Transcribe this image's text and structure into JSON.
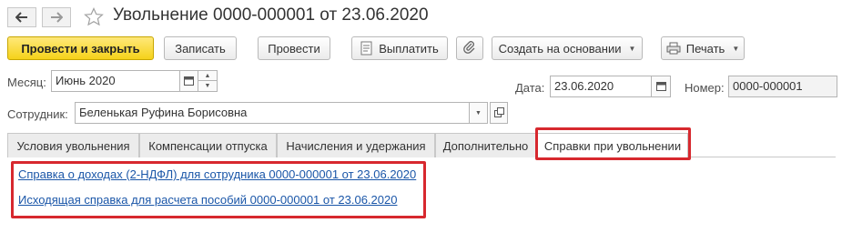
{
  "window": {
    "title": "Увольнение 0000-000001 от 23.06.2020"
  },
  "toolbar": {
    "post_close_label": "Провести и закрыть",
    "save_label": "Записать",
    "post_label": "Провести",
    "pay_label": "Выплатить",
    "create_based_label": "Создать на основании",
    "print_label": "Печать"
  },
  "form": {
    "month_label": "Месяц:",
    "month_value": "Июнь 2020",
    "date_label": "Дата:",
    "date_value": "23.06.2020",
    "number_label": "Номер:",
    "number_value": "0000-000001",
    "employee_label": "Сотрудник:",
    "employee_value": "Беленькая Руфина Борисовна"
  },
  "tabs": [
    {
      "label": "Условия увольнения"
    },
    {
      "label": "Компенсации отпуска"
    },
    {
      "label": "Начисления и удержания"
    },
    {
      "label": "Дополнительно"
    },
    {
      "label": "Справки при увольнении",
      "active": true
    }
  ],
  "certificates": {
    "links": [
      {
        "label": "Справка о доходах (2-НДФЛ) для сотрудника 0000-000001 от 23.06.2020"
      },
      {
        "label": "Исходящая справка для расчета пособий 0000-000001 от 23.06.2020"
      }
    ]
  },
  "colors": {
    "primary_button": "#f5d21a",
    "highlight_frame": "#d7282e",
    "link": "#1a56a8"
  },
  "icons": [
    "back-arrow-icon",
    "forward-arrow-icon",
    "favorite-star-icon",
    "calendar-icon",
    "spin-up-icon",
    "spin-down-icon",
    "dropdown-icon",
    "open-icon",
    "pay-document-icon",
    "paperclip-icon",
    "printer-icon"
  ]
}
